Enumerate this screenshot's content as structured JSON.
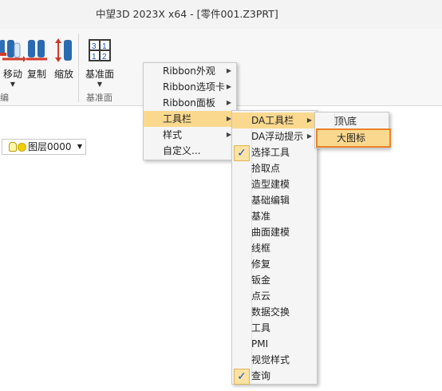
{
  "window": {
    "title": "中望3D 2023X x64 - [零件001.Z3PRT]"
  },
  "ribbon": {
    "buttons": [
      {
        "label": "移动",
        "icon": "move-icon"
      },
      {
        "label": "复制",
        "icon": "copy-icon"
      },
      {
        "label": "缩放",
        "icon": "scale-icon"
      },
      {
        "label": "基准面",
        "icon": "datum-plane-icon"
      }
    ],
    "groups": [
      {
        "label": "编"
      },
      {
        "label": "基准面"
      }
    ]
  },
  "layer_dropdown": {
    "value": "图层0000"
  },
  "context_menu": {
    "items": [
      {
        "label": "Ribbon外观",
        "has_submenu": true
      },
      {
        "label": "Ribbon选项卡",
        "has_submenu": true
      },
      {
        "label": "Ribbon面板",
        "has_submenu": true
      },
      {
        "label": "工具栏",
        "has_submenu": true,
        "highlighted": true
      },
      {
        "label": "样式",
        "has_submenu": true
      },
      {
        "label": "自定义...",
        "has_submenu": false
      }
    ]
  },
  "toolbar_submenu": {
    "items": [
      {
        "label": "DA工具栏",
        "has_submenu": true,
        "highlighted": true,
        "checked": false
      },
      {
        "label": "DA浮动提示",
        "has_submenu": true,
        "checked": false
      },
      {
        "label": "选择工具",
        "checked": true
      },
      {
        "label": "拾取点",
        "checked": false
      },
      {
        "label": "造型建模",
        "checked": false
      },
      {
        "label": "基础编辑",
        "checked": false
      },
      {
        "label": "基准",
        "checked": false
      },
      {
        "label": "曲面建模",
        "checked": false
      },
      {
        "label": "线框",
        "checked": false
      },
      {
        "label": "修复",
        "checked": false
      },
      {
        "label": "钣金",
        "checked": false
      },
      {
        "label": "点云",
        "checked": false
      },
      {
        "label": "数据交换",
        "checked": false
      },
      {
        "label": "工具",
        "checked": false
      },
      {
        "label": "PMI",
        "checked": false
      },
      {
        "label": "视觉样式",
        "checked": false
      },
      {
        "label": "查询",
        "checked": true
      }
    ],
    "check_mark": "✓"
  },
  "da_submenu": {
    "items": [
      {
        "label": "顶\\底"
      },
      {
        "label": "大图标",
        "highlighted": true
      }
    ]
  },
  "colors": {
    "highlight": "#fad98f",
    "focus_border": "#e8822a",
    "check_blue": "#1a4fd6"
  }
}
